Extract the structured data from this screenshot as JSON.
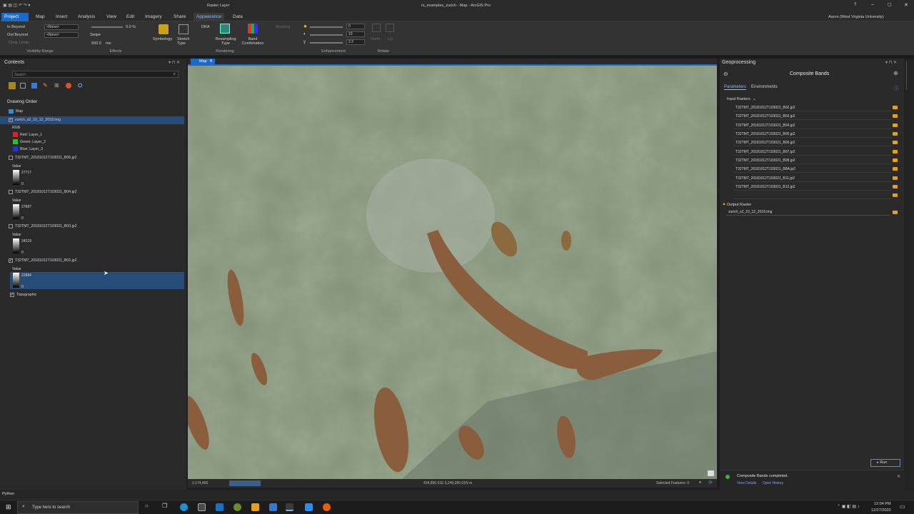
{
  "window": {
    "title": "rs_examples_zurich - Map - ArcGIS Pro",
    "context_tab": "Raster Layer",
    "user": "Aaron (West Virginia University)"
  },
  "ribbon_tabs": [
    "Project",
    "Map",
    "Insert",
    "Analysis",
    "View",
    "Edit",
    "Imagery",
    "Share",
    "Appearance",
    "Data"
  ],
  "ribbon": {
    "in_beyond": "In Beyond",
    "out_beyond": "Out Beyond",
    "clear_limits": "Clear Limits",
    "none1": "<None>",
    "none2": "<None>",
    "visibility_range": "Visibility Range",
    "transparency": "0.0 %",
    "swipe": "Swipe",
    "flicker": "500.0",
    "flicker_unit": "ms",
    "effects": "Effects",
    "symbology": "Symbology",
    "stretch_type": "Stretch Type",
    "dra": "DRA",
    "resampling_type": "Resampling Type",
    "band_combination": "Band Combination",
    "masking": "Masking",
    "rendering": "Rendering",
    "brightness": "0",
    "contrast": "10",
    "gamma": "2.2",
    "enhancement": "Enhancement",
    "north": "North",
    "up": "Up",
    "rotate": "Rotate"
  },
  "contents": {
    "title": "Contents",
    "search_placeholder": "Search",
    "drawing_order": "Drawing Order",
    "map": "Map",
    "composite_layer": "zurich_s2_10_12_2018.img",
    "rgb": "RGB",
    "red": "Red:  Layer_1",
    "green": "Green: Layer_2",
    "blue": "Blue:  Layer_3",
    "bands": [
      {
        "name": "T32TMT_20181012T103021_B06.jp2",
        "value_label": "Value",
        "max": "27717",
        "min": "0"
      },
      {
        "name": "T32TMT_20181012T103021_B04.jp2",
        "value_label": "Value",
        "max": "27687",
        "min": "0"
      },
      {
        "name": "T32TMT_20181012T103021_B03.jp2",
        "value_label": "Value",
        "max": "24219",
        "min": "0"
      },
      {
        "name": "T32TMT_20181012T103021_B02.jp2",
        "value_label": "Value",
        "max": "22884",
        "min": "0"
      }
    ],
    "topographic": "Topographic"
  },
  "map": {
    "tab": "Map",
    "scale": "1:174,466",
    "coords": "434,896.51E 5,249,285.01N m",
    "selected_features": "Selected Features: 0"
  },
  "geoprocessing": {
    "title": "Geoprocessing",
    "tool": "Composite Bands",
    "tab_parameters": "Parameters",
    "tab_environments": "Environments",
    "input_rasters_label": "Input Rasters",
    "input_rasters": [
      "T32TMT_20181012T103021_B02.jp2",
      "T32TMT_20181012T103021_B03.jp2",
      "T32TMT_20181012T103021_B04.jp2",
      "T32TMT_20181012T103021_B05.jp2",
      "T32TMT_20181012T103021_B06.jp2",
      "T32TMT_20181012T103021_B07.jp2",
      "T32TMT_20181012T103021_B08.jp2",
      "T32TMT_20181012T103021_B8A.jp2",
      "T32TMT_20181012T103021_B11.jp2",
      "T32TMT_20181012T103021_B12.jp2"
    ],
    "output_raster_label": "Output Raster",
    "output_raster": "zurich_s2_10_12_2018.img",
    "run": "Run",
    "completed": "Composite Bands completed.",
    "view_details": "View Details",
    "open_history": "Open History"
  },
  "statusbar": {
    "python": "Python"
  },
  "taskbar": {
    "search_placeholder": "Type here to search",
    "time": "12:04 PM",
    "date": "12/27/2020"
  },
  "colors": {
    "accent": "#1b6ac9",
    "selection": "#274c7a",
    "lake": "#8a5e3c",
    "folder": "#e3a21a"
  }
}
